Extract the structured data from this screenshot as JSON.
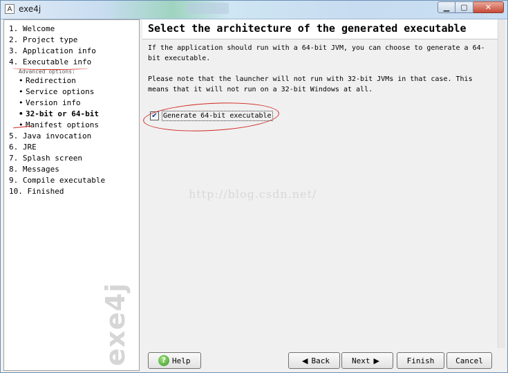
{
  "window": {
    "title": "exe4j",
    "app_icon_glyph": "A",
    "controls": {
      "minimize": "▁",
      "maximize": "▢",
      "close": "✕"
    }
  },
  "sidebar": {
    "steps_top": [
      {
        "label": "1. Welcome"
      },
      {
        "label": "2. Project type"
      },
      {
        "label": "3. Application info"
      },
      {
        "label": "4. Executable info"
      }
    ],
    "advanced_label": "Advanced options:",
    "sub_steps": [
      {
        "label": "Redirection",
        "current": false
      },
      {
        "label": "Service options",
        "current": false
      },
      {
        "label": "Version info",
        "current": false
      },
      {
        "label": "32-bit or 64-bit",
        "current": true
      },
      {
        "label": "Manifest options",
        "current": false
      }
    ],
    "steps_bottom": [
      {
        "label": "5. Java invocation"
      },
      {
        "label": "6. JRE"
      },
      {
        "label": "7. Splash screen"
      },
      {
        "label": "8. Messages"
      },
      {
        "label": "9. Compile executable"
      },
      {
        "label": "10. Finished"
      }
    ],
    "bullet": "•",
    "brand_text": "exe4j"
  },
  "main": {
    "title": "Select the architecture of the generated executable",
    "paragraph1": "If the application should run with a 64-bit JVM, you can choose to generate a 64-bit executable.",
    "paragraph2": "Please note that the launcher will not run with 32-bit JVMs in that case. This means that it will not run on a 32-bit Windows at all.",
    "checkbox": {
      "label": "Generate 64-bit executable",
      "checked": true,
      "check_glyph": "✔"
    },
    "watermark": "http://blog.csdn.net/"
  },
  "buttons": {
    "help": "Help",
    "help_glyph": "?",
    "back": "Back",
    "back_arrow": "◀",
    "next": "Next",
    "next_arrow": "▶",
    "finish": "Finish",
    "cancel": "Cancel"
  },
  "colors": {
    "annotation_red": "#d0261f",
    "help_green": "#3a9a2a"
  }
}
